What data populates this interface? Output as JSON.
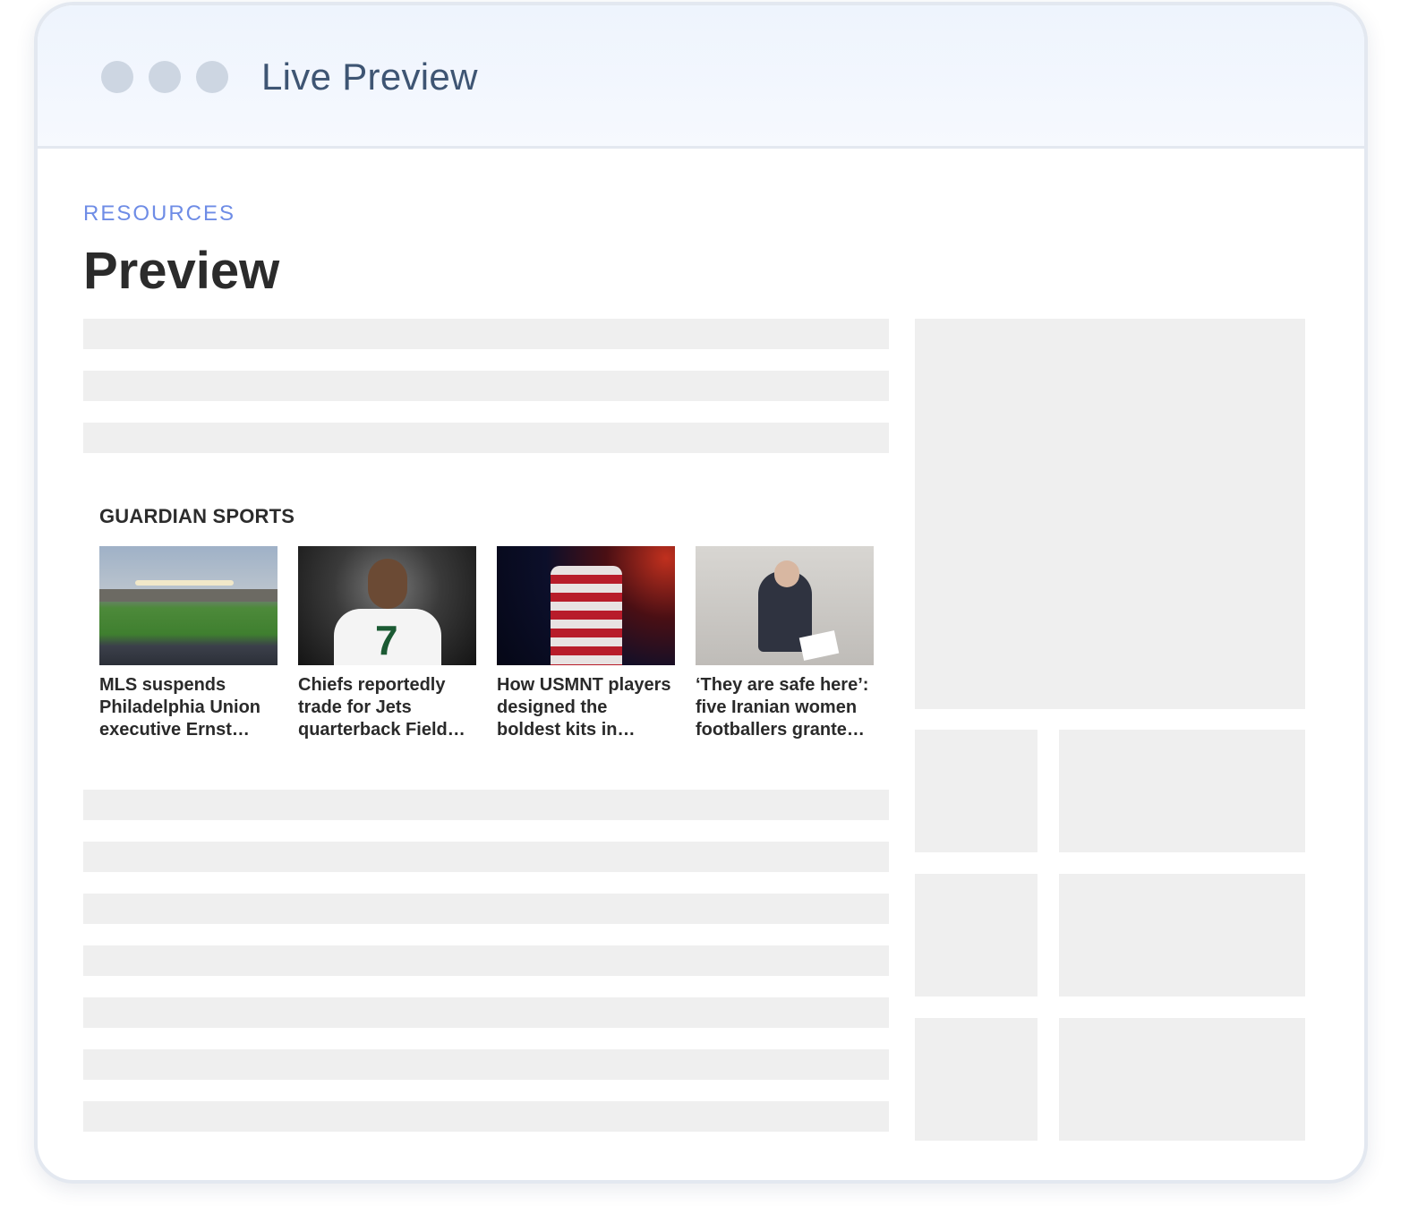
{
  "window": {
    "title": "Live Preview"
  },
  "page": {
    "eyebrow": "RESOURCES",
    "title": "Preview"
  },
  "widget": {
    "section_title": "GUARDIAN SPORTS",
    "articles": [
      {
        "headline": "MLS suspends Philadelphia Union executive Ernst…",
        "image": "stadium-photo"
      },
      {
        "headline": "Chiefs reportedly trade for Jets quarterback Field…",
        "image": "football-player-photo"
      },
      {
        "headline": "How USMNT players designed the boldest kits in…",
        "image": "jersey-photo"
      },
      {
        "headline": "‘They are safe here’: five Iranian women footballers grante…",
        "image": "signing-photo"
      }
    ]
  },
  "colors": {
    "accent": "#6e8ce6",
    "placeholder": "#efefef",
    "window_border": "#e3e8f0"
  }
}
